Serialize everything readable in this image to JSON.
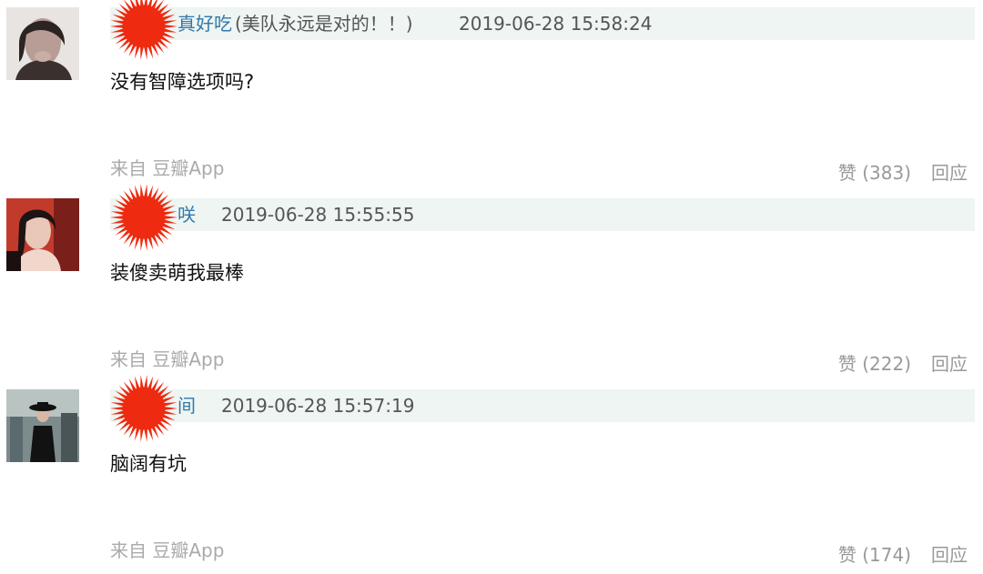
{
  "comments": [
    {
      "author": "真好吃",
      "signature": "(美队永远是对的！！)",
      "time": "2019-06-28 15:58:24",
      "content": "没有智障选项吗?",
      "source": "来自 豆瓣App",
      "vote": "赞 (383)",
      "reply": "回应"
    },
    {
      "author": "咲",
      "time": "2019-06-28 15:55:55",
      "content": "装傻卖萌我最棒",
      "source": "来自 豆瓣App",
      "vote": "赞 (222)",
      "reply": "回应"
    },
    {
      "author": "间",
      "time": "2019-06-28 15:57:19",
      "content": "脑阔有坑",
      "source": "来自 豆瓣App",
      "vote": "赞 (174)",
      "reply": "回应"
    }
  ],
  "colors": {
    "author_link": "#3377aa",
    "header_bg": "#eef5f2",
    "redaction": "#ee2a10",
    "muted": "#999999"
  }
}
